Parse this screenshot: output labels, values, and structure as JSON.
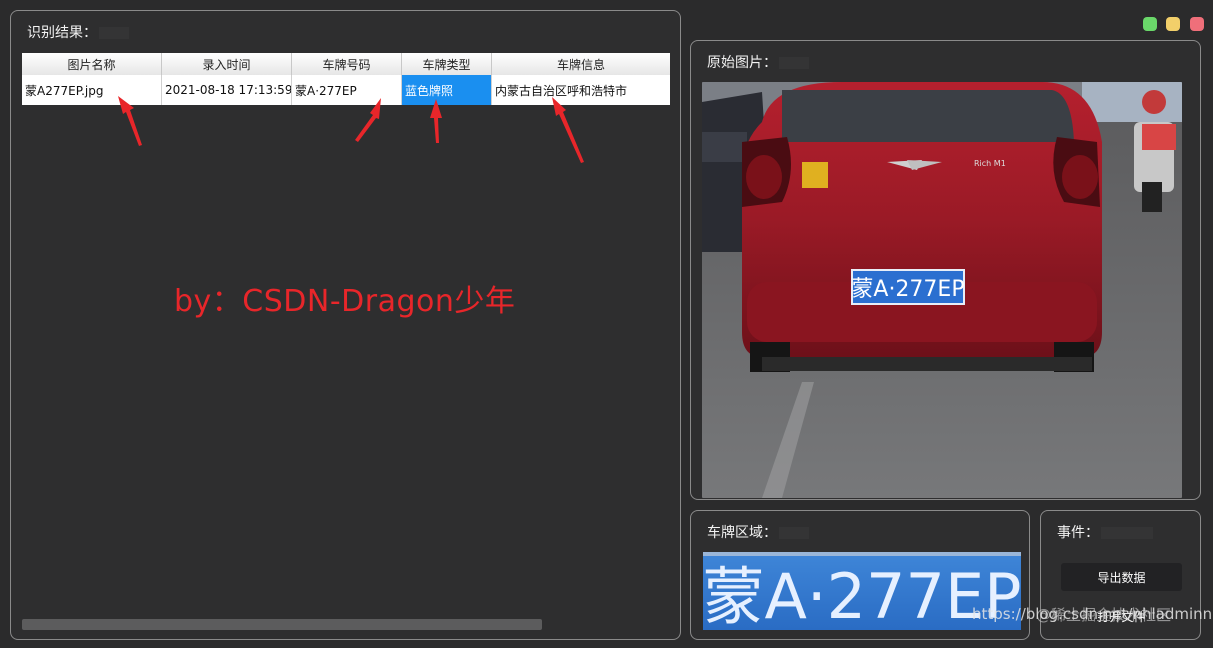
{
  "window": {
    "buttons": [
      {
        "name": "maximize",
        "color": "#6ad86a"
      },
      {
        "name": "minimize",
        "color": "#f2cf6a"
      },
      {
        "name": "close",
        "color": "#ef6f7a"
      }
    ]
  },
  "results": {
    "title": "识别结果：",
    "columns": [
      "图片名称",
      "录入时间",
      "车牌号码",
      "车牌类型",
      "车牌信息"
    ],
    "rows": [
      [
        "蒙A277EP.jpg",
        "2021-08-18 17:13:59",
        "蒙A·277EP",
        "蓝色牌照",
        "内蒙古自治区呼和浩特市"
      ]
    ]
  },
  "watermark": "by：CSDN-Dragon少年",
  "original": {
    "title": "原始图片："
  },
  "photo": {
    "plate_text": "蒙A·277EP",
    "badge": "Rich M1"
  },
  "plate_region": {
    "title": "车牌区域：",
    "plate_text": "蒙A·277EP"
  },
  "events": {
    "title": "事件：",
    "export_label": "导出数据",
    "open_label": "打开文件"
  },
  "site_watermark": {
    "line1": "@稀土掘金技术社区",
    "line2": "https://blog.csdn.net/nhladminnhl"
  },
  "colors": {
    "accent": "#1a8ff0",
    "watermark_red": "#e8262a",
    "panel_bg": "#2e2e2f"
  }
}
